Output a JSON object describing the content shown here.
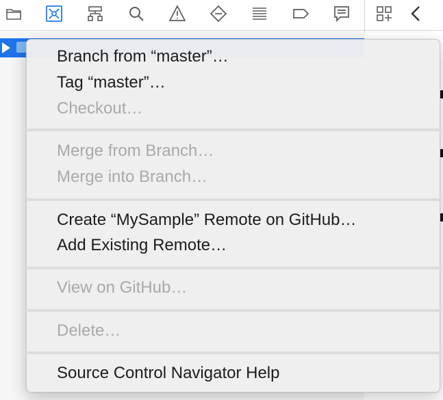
{
  "toolbar": {
    "icons": [
      "folder-icon",
      "source-control-icon",
      "hierarchy-icon",
      "search-icon",
      "warning-icon",
      "breakpoint-diamond-icon",
      "list-icon",
      "tag-icon",
      "comment-icon"
    ],
    "active": "source-control-icon",
    "accent_color": "#1f7ae6"
  },
  "right_toolbar": {
    "icons": [
      "grid-add-icon",
      "chevron-left-icon"
    ]
  },
  "navigator": {
    "selected_row_color": "#1f74e8"
  },
  "context_menu": {
    "groups": [
      {
        "items": [
          {
            "label": "Branch from “master”…",
            "enabled": true
          },
          {
            "label": "Tag “master”…",
            "enabled": true
          },
          {
            "label": "Checkout…",
            "enabled": false
          }
        ]
      },
      {
        "items": [
          {
            "label": "Merge from Branch…",
            "enabled": false
          },
          {
            "label": "Merge into Branch…",
            "enabled": false
          }
        ]
      },
      {
        "items": [
          {
            "label": "Create “MySample” Remote on GitHub…",
            "enabled": true
          },
          {
            "label": "Add Existing Remote…",
            "enabled": true
          }
        ]
      },
      {
        "items": [
          {
            "label": "View on GitHub…",
            "enabled": false
          }
        ]
      },
      {
        "items": [
          {
            "label": "Delete…",
            "enabled": false
          }
        ]
      },
      {
        "items": [
          {
            "label": "Source Control Navigator Help",
            "enabled": true
          }
        ]
      }
    ]
  }
}
